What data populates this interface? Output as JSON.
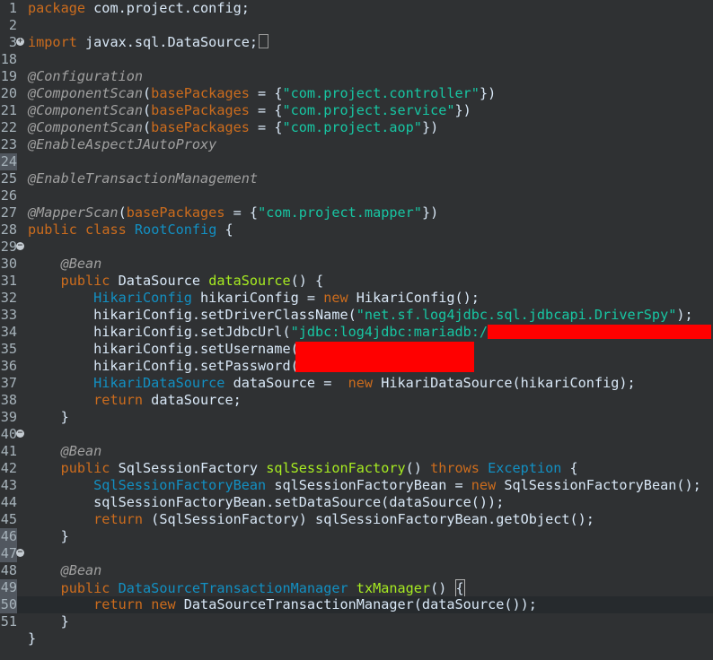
{
  "editor": {
    "line_numbers": [
      "1",
      "2",
      "3",
      "18",
      "19",
      "20",
      "21",
      "22",
      "23",
      "24",
      "25",
      "26",
      "27",
      "28",
      "29",
      "30",
      "31",
      "32",
      "33",
      "34",
      "35",
      "36",
      "37",
      "38",
      "39",
      "40",
      "41",
      "42",
      "43",
      "44",
      "45",
      "46",
      "47",
      "48",
      "49",
      "50",
      "51"
    ],
    "lines": [
      [
        {
          "t": "kw",
          "v": "package"
        },
        {
          "t": "plain",
          "v": " com.project.config;"
        }
      ],
      [],
      [
        {
          "t": "kw",
          "v": "import"
        },
        {
          "t": "plain",
          "v": " javax.sql.DataSource;"
        }
      ],
      [],
      [
        {
          "t": "ann",
          "v": "@Configuration"
        }
      ],
      [
        {
          "t": "ann",
          "v": "@ComponentScan"
        },
        {
          "t": "plain",
          "v": "("
        },
        {
          "t": "kw",
          "v": "basePackages"
        },
        {
          "t": "plain",
          "v": " = {"
        },
        {
          "t": "str",
          "v": "\"com.project.controller\""
        },
        {
          "t": "plain",
          "v": "})"
        }
      ],
      [
        {
          "t": "ann",
          "v": "@ComponentScan"
        },
        {
          "t": "plain",
          "v": "("
        },
        {
          "t": "kw",
          "v": "basePackages"
        },
        {
          "t": "plain",
          "v": " = {"
        },
        {
          "t": "str",
          "v": "\"com.project.service\""
        },
        {
          "t": "plain",
          "v": "})"
        }
      ],
      [
        {
          "t": "ann",
          "v": "@ComponentScan"
        },
        {
          "t": "plain",
          "v": "("
        },
        {
          "t": "kw",
          "v": "basePackages"
        },
        {
          "t": "plain",
          "v": " = {"
        },
        {
          "t": "str",
          "v": "\"com.project.aop\""
        },
        {
          "t": "plain",
          "v": "})"
        }
      ],
      [
        {
          "t": "ann",
          "v": "@EnableAspectJAutoProxy"
        }
      ],
      [],
      [
        {
          "t": "ann",
          "v": "@EnableTransactionManagement"
        }
      ],
      [],
      [
        {
          "t": "ann",
          "v": "@MapperScan"
        },
        {
          "t": "plain",
          "v": "("
        },
        {
          "t": "kw",
          "v": "basePackages"
        },
        {
          "t": "plain",
          "v": " = {"
        },
        {
          "t": "str",
          "v": "\"com.project.mapper\""
        },
        {
          "t": "plain",
          "v": "})"
        }
      ],
      [
        {
          "t": "kw",
          "v": "public"
        },
        {
          "t": "plain",
          "v": " "
        },
        {
          "t": "kw",
          "v": "class"
        },
        {
          "t": "plain",
          "v": " "
        },
        {
          "t": "typ",
          "v": "RootConfig"
        },
        {
          "t": "plain",
          "v": " {"
        }
      ],
      [],
      [
        {
          "t": "plain",
          "v": "    "
        },
        {
          "t": "ann",
          "v": "@Bean"
        }
      ],
      [
        {
          "t": "plain",
          "v": "    "
        },
        {
          "t": "kw",
          "v": "public"
        },
        {
          "t": "plain",
          "v": " DataSource "
        },
        {
          "t": "mtd",
          "v": "dataSource"
        },
        {
          "t": "plain",
          "v": "() {"
        }
      ],
      [
        {
          "t": "plain",
          "v": "        "
        },
        {
          "t": "typ",
          "v": "HikariConfig"
        },
        {
          "t": "plain",
          "v": " hikariConfig = "
        },
        {
          "t": "kw",
          "v": "new"
        },
        {
          "t": "plain",
          "v": " HikariConfig();"
        }
      ],
      [
        {
          "t": "plain",
          "v": "        hikariConfig.setDriverClassName("
        },
        {
          "t": "str",
          "v": "\"net.sf.log4jdbc.sql.jdbcapi.DriverSpy\""
        },
        {
          "t": "plain",
          "v": ");"
        }
      ],
      [
        {
          "t": "plain",
          "v": "        hikariConfig.setJdbcUrl("
        },
        {
          "t": "str",
          "v": "\"jdbc:log4jdbc:mariadb://"
        }
      ],
      [
        {
          "t": "plain",
          "v": "        hikariConfig.setUsername("
        }
      ],
      [
        {
          "t": "plain",
          "v": "        hikariConfig.setPassword("
        }
      ],
      [
        {
          "t": "plain",
          "v": "        "
        },
        {
          "t": "typ",
          "v": "HikariDataSource"
        },
        {
          "t": "plain",
          "v": " dataSource =  "
        },
        {
          "t": "kw",
          "v": "new"
        },
        {
          "t": "plain",
          "v": " HikariDataSource(hikariConfig);"
        }
      ],
      [
        {
          "t": "plain",
          "v": "        "
        },
        {
          "t": "kw",
          "v": "return"
        },
        {
          "t": "plain",
          "v": " dataSource;"
        }
      ],
      [
        {
          "t": "plain",
          "v": "    }"
        }
      ],
      [],
      [
        {
          "t": "plain",
          "v": "    "
        },
        {
          "t": "ann",
          "v": "@Bean"
        }
      ],
      [
        {
          "t": "plain",
          "v": "    "
        },
        {
          "t": "kw",
          "v": "public"
        },
        {
          "t": "plain",
          "v": " SqlSessionFactory "
        },
        {
          "t": "mtd",
          "v": "sqlSessionFactory"
        },
        {
          "t": "plain",
          "v": "() "
        },
        {
          "t": "kw",
          "v": "throws"
        },
        {
          "t": "plain",
          "v": " "
        },
        {
          "t": "typ",
          "v": "Exception"
        },
        {
          "t": "plain",
          "v": " {"
        }
      ],
      [
        {
          "t": "plain",
          "v": "        "
        },
        {
          "t": "typ",
          "v": "SqlSessionFactoryBean"
        },
        {
          "t": "plain",
          "v": " sqlSessionFactoryBean = "
        },
        {
          "t": "kw",
          "v": "new"
        },
        {
          "t": "plain",
          "v": " SqlSessionFactoryBean();"
        }
      ],
      [
        {
          "t": "plain",
          "v": "        sqlSessionFactoryBean.setDataSource(dataSource());"
        }
      ],
      [
        {
          "t": "plain",
          "v": "        "
        },
        {
          "t": "kw",
          "v": "return"
        },
        {
          "t": "plain",
          "v": " (SqlSessionFactory) sqlSessionFactoryBean.getObject();"
        }
      ],
      [
        {
          "t": "plain",
          "v": "    }"
        }
      ],
      [],
      [
        {
          "t": "plain",
          "v": "    "
        },
        {
          "t": "ann",
          "v": "@Bean"
        }
      ],
      [
        {
          "t": "plain",
          "v": "    "
        },
        {
          "t": "kw",
          "v": "public"
        },
        {
          "t": "plain",
          "v": " "
        },
        {
          "t": "typ",
          "v": "DataSourceTransactionManager"
        },
        {
          "t": "plain",
          "v": " "
        },
        {
          "t": "mtd",
          "v": "txManager"
        },
        {
          "t": "plain",
          "v": "() "
        },
        {
          "t": "cursor",
          "v": "{"
        }
      ],
      [
        {
          "t": "plain",
          "v": "        "
        },
        {
          "t": "kw",
          "v": "return"
        },
        {
          "t": "plain",
          "v": " "
        },
        {
          "t": "kw",
          "v": "new"
        },
        {
          "t": "plain",
          "v": " DataSourceTransactionManager(dataSource());"
        }
      ],
      [
        {
          "t": "plain",
          "v": "    }"
        }
      ],
      [
        {
          "t": "plain",
          "v": "}"
        }
      ]
    ],
    "fold_markers": {
      "2": "+",
      "14": "-",
      "25": "-",
      "32": "-"
    },
    "highlighted_gutter": [
      9,
      31,
      32,
      34,
      35
    ],
    "current_line": 35,
    "colors": {
      "background": "#2f3133",
      "keyword": "#cc6c1d",
      "annotation": "#a0a0a0",
      "type": "#1290c3",
      "method": "#a7ec21",
      "string": "#17c6a3",
      "text": "#d9e8f7",
      "redaction": "#ff0000"
    }
  }
}
